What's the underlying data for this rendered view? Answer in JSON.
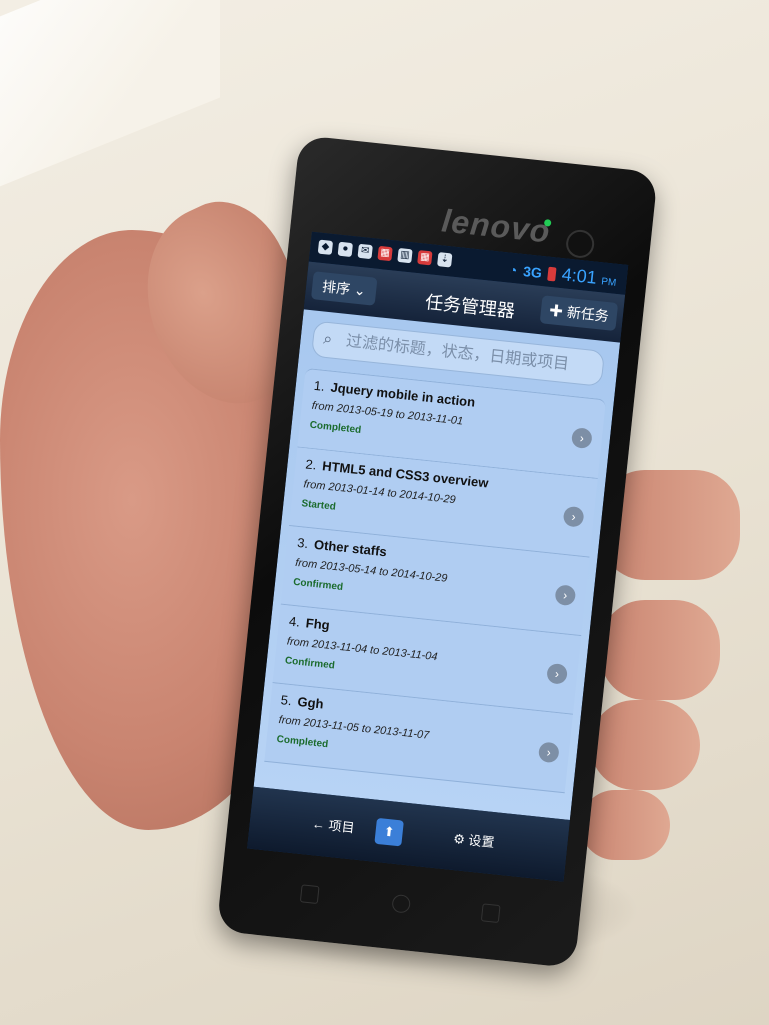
{
  "device": {
    "brand": "lenovo",
    "status_time": "4:01",
    "status_ampm": "PM",
    "network": "3G"
  },
  "app": {
    "sort_label": "排序",
    "title": "任务管理器",
    "new_task_label": "新任务",
    "search_placeholder": "过滤的标题，状态，日期或项目",
    "tasks": [
      {
        "num": "1.",
        "title": "Jquery mobile in action",
        "dates": "from 2013-05-19 to 2013-11-01",
        "status": "Completed"
      },
      {
        "num": "2.",
        "title": "HTML5 and CSS3 overview",
        "dates": "from 2013-01-14 to 2014-10-29",
        "status": "Started"
      },
      {
        "num": "3.",
        "title": "Other staffs",
        "dates": "from 2013-05-14 to 2014-10-29",
        "status": "Confirmed"
      },
      {
        "num": "4.",
        "title": "Fhg",
        "dates": "from 2013-11-04 to 2013-11-04",
        "status": "Confirmed"
      },
      {
        "num": "5.",
        "title": "Ggh",
        "dates": "from 2013-11-05 to 2013-11-07",
        "status": "Completed"
      }
    ],
    "footer": {
      "left_label": "项目",
      "right_label": "设置"
    }
  }
}
